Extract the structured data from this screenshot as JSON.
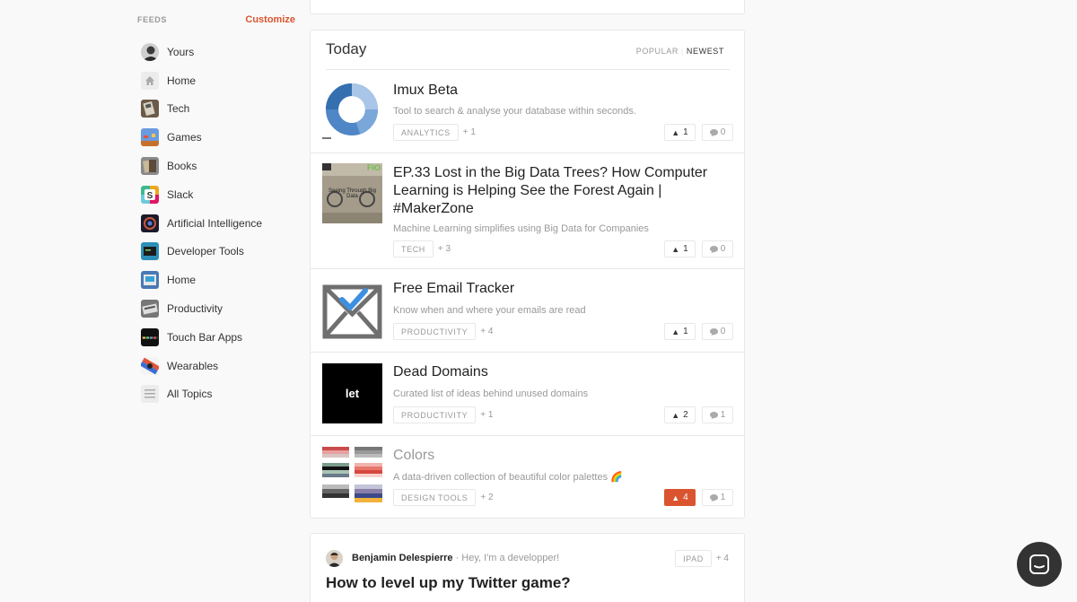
{
  "sidebar": {
    "title": "FEEDS",
    "customize_label": "Customize",
    "items": [
      {
        "label": "Yours",
        "icon": "user-avatar-icon"
      },
      {
        "label": "Home",
        "icon": "home-icon"
      },
      {
        "label": "Tech",
        "icon": "tech-icon"
      },
      {
        "label": "Games",
        "icon": "games-icon"
      },
      {
        "label": "Books",
        "icon": "books-icon"
      },
      {
        "label": "Slack",
        "icon": "slack-icon"
      },
      {
        "label": "Artificial Intelligence",
        "icon": "ai-icon"
      },
      {
        "label": "Developer Tools",
        "icon": "developer-tools-icon"
      },
      {
        "label": "Home",
        "icon": "home-topic-icon"
      },
      {
        "label": "Productivity",
        "icon": "productivity-icon"
      },
      {
        "label": "Touch Bar Apps",
        "icon": "touch-bar-icon"
      },
      {
        "label": "Wearables",
        "icon": "wearables-icon"
      },
      {
        "label": "All Topics",
        "icon": "list-icon"
      }
    ]
  },
  "feed": {
    "title": "Today",
    "sort_popular": "POPULAR",
    "sort_newest": "NEWEST",
    "posts": [
      {
        "name": "Imux Beta",
        "tagline": "Tool to search & analyse your database within seconds.",
        "topic": "ANALYTICS",
        "more": "+ 1",
        "votes": "1",
        "comments": "0",
        "thumb": "donut-chart-thumb"
      },
      {
        "name": "EP.33 Lost in the Big Data Trees? How Computer Learning is Helping See the Forest Again | #MakerZone",
        "tagline": "Machine Learning simplifies using Big Data for Companies",
        "topic": "TECH",
        "more": "+ 3",
        "votes": "1",
        "comments": "0",
        "thumb": "podcast-thumb",
        "thumb_text": "Seeing Through Big Data",
        "thumb_badge": "FiO"
      },
      {
        "name": "Free Email Tracker",
        "tagline": "Know when and where your emails are read",
        "topic": "PRODUCTIVITY",
        "more": "+ 4",
        "votes": "1",
        "comments": "0",
        "thumb": "envelope-check-thumb"
      },
      {
        "name": "Dead Domains",
        "tagline": "Curated list of ideas behind unused domains",
        "topic": "PRODUCTIVITY",
        "more": "+ 1",
        "votes": "2",
        "comments": "1",
        "thumb": "let-logo-thumb",
        "thumb_text": "let"
      },
      {
        "name": "Colors",
        "tagline": "A data-driven collection of beautiful color palettes 🌈",
        "topic": "DESIGN TOOLS",
        "more": "+ 2",
        "votes": "4",
        "comments": "1",
        "thumb": "palette-thumb",
        "upvoted": true
      }
    ]
  },
  "discussion": {
    "author": "Benjamin Delespierre",
    "headline": " · Hey, I'm a developper!",
    "topic": "IPAD",
    "more": "+ 4",
    "title": "How to level up my Twitter game?"
  },
  "colors": {
    "accent": "#da552f",
    "border": "#e8e8e8",
    "background": "#f9f9f9"
  }
}
